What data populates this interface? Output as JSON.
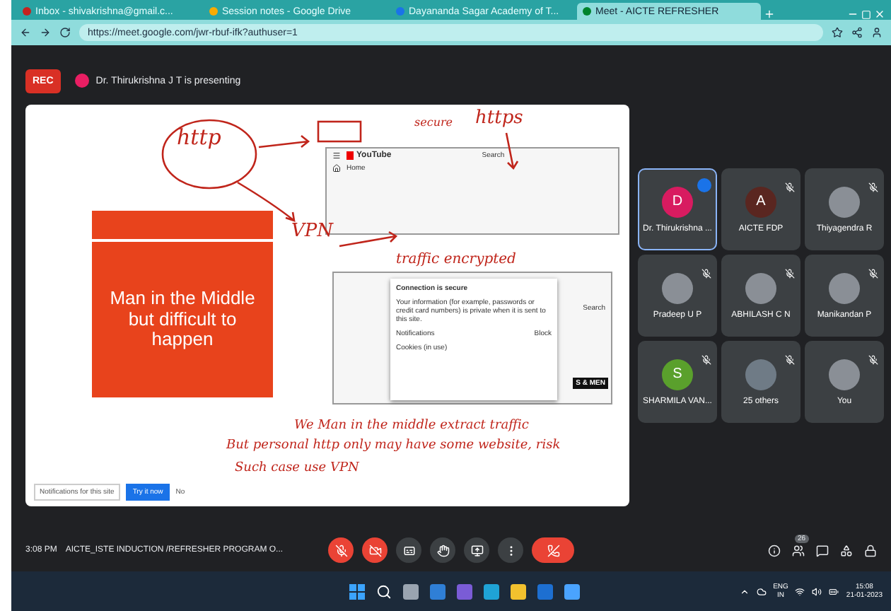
{
  "browser": {
    "tabs": [
      {
        "title": "Inbox - shivakrishna@gmail.c...",
        "selected": false
      },
      {
        "title": "Session notes - Google Drive",
        "selected": false
      },
      {
        "title": "Dayananda Sagar Academy of T...",
        "selected": false
      },
      {
        "title": "Meet - AICTE REFRESHER",
        "selected": true
      }
    ],
    "url": "https://meet.google.com/jwr-rbuf-ifk?authuser=1"
  },
  "meeting": {
    "recording": true,
    "rec_label": "REC",
    "presenter": "Dr. Thirukrishna J T is presenting"
  },
  "slide": {
    "callout": "Man in the Middle but difficult to happen",
    "shot_top": {
      "logo": "YouTube",
      "search": "Search",
      "menu_item": "Home"
    },
    "shot_bottom": {
      "popup_title": "Connection is secure",
      "popup_text": "Your information (for example, passwords or credit card numbers) is private when it is sent to this site.",
      "setting": "Notifications",
      "setting_value": "Block",
      "cookies": "Cookies (in use)",
      "search": "Search",
      "thumb": "S & MEN"
    },
    "notes": [
      "http",
      "https",
      "secure",
      "VPN",
      "traffic encrypted",
      "We Man in the middle extract traffic",
      "But personal http only may have some website, risk",
      "Such case use VPN"
    ],
    "banner": {
      "text": "Notifications for this site",
      "button": "Try it now",
      "dismiss": "No"
    }
  },
  "participants": [
    {
      "name": "Dr. Thirukrishna ...",
      "kind": "letter",
      "initial": "D",
      "color": "#d81b60",
      "speaking": true,
      "muted": false
    },
    {
      "name": "AICTE FDP",
      "kind": "letter",
      "initial": "A",
      "color": "#5a2620",
      "speaking": false,
      "muted": true
    },
    {
      "name": "Thiyagendra R",
      "kind": "photo",
      "speaking": false,
      "muted": true
    },
    {
      "name": "Pradeep U P",
      "kind": "photo",
      "speaking": false,
      "muted": true
    },
    {
      "name": "ABHILASH C N",
      "kind": "photo",
      "speaking": false,
      "muted": true
    },
    {
      "name": "Manikandan P",
      "kind": "photo",
      "speaking": false,
      "muted": true
    },
    {
      "name": "SHARMILA VAN...",
      "kind": "letter",
      "initial": "S",
      "color": "#5aa02c",
      "speaking": false,
      "muted": true
    },
    {
      "name": "25 others",
      "kind": "group",
      "speaking": false,
      "muted": true
    },
    {
      "name": "You",
      "kind": "photo",
      "speaking": false,
      "muted": true
    }
  ],
  "bottom": {
    "time": "3:08 PM",
    "title": "AICTE_ISTE INDUCTION /REFRESHER PROGRAM O...",
    "controls": [
      {
        "kind": "mic",
        "off": true
      },
      {
        "kind": "camera",
        "off": true
      },
      {
        "kind": "captions",
        "off": false
      },
      {
        "kind": "hand",
        "off": false
      },
      {
        "kind": "present",
        "off": false
      },
      {
        "kind": "more",
        "off": false
      },
      {
        "kind": "leave"
      }
    ],
    "people_count": "26"
  },
  "taskbar": {
    "lang": "ENG",
    "region": "IN",
    "time": "15:08",
    "date": "21-01-2023"
  }
}
